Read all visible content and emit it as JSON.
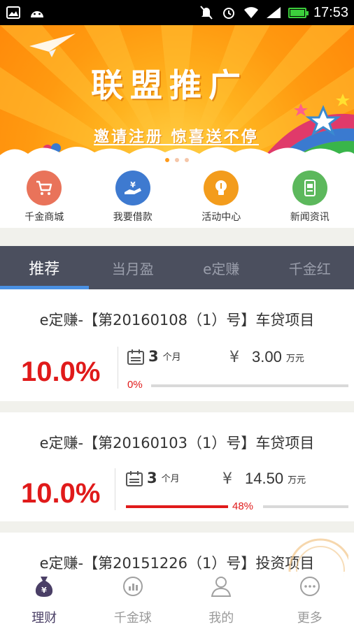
{
  "status_bar": {
    "time": "17:53",
    "left_icons": [
      "image-icon",
      "android-icon"
    ],
    "right_icons": [
      "mute-icon",
      "alarm-icon",
      "wifi-icon",
      "signal-icon",
      "battery-icon"
    ]
  },
  "banner": {
    "title": "联盟推广",
    "subtitle": "邀请注册 惊喜送不停",
    "page_count": 3,
    "active_page": 1
  },
  "quick_menu": [
    {
      "label": "千金商城",
      "icon": "shopping-cart-icon",
      "color": "#e9735a"
    },
    {
      "label": "我要借款",
      "icon": "loan-hand-icon",
      "color": "#3e7ad0"
    },
    {
      "label": "活动中心",
      "icon": "lightbulb-icon",
      "color": "#f39c1c"
    },
    {
      "label": "新闻资讯",
      "icon": "news-icon",
      "color": "#5cb85c"
    }
  ],
  "tabs": [
    {
      "label": "推荐",
      "active": true
    },
    {
      "label": "当月盈",
      "active": false
    },
    {
      "label": "e定赚",
      "active": false
    },
    {
      "label": "千金红",
      "active": false
    }
  ],
  "products": [
    {
      "title": "e定赚-【第20160108（1）号】车贷项目",
      "rate": "10.0%",
      "period": "3",
      "period_unit": "个月",
      "yen": "¥",
      "amount": "3.00",
      "amount_unit": "万元",
      "progress_label": "0%",
      "progress": 0
    },
    {
      "title": "e定赚-【第20160103（1）号】车贷项目",
      "rate": "10.0%",
      "period": "3",
      "period_unit": "个月",
      "yen": "¥",
      "amount": "14.50",
      "amount_unit": "万元",
      "progress_label": "48%",
      "progress": 0.48
    },
    {
      "title": "e定赚-【第20151226（1）号】投资项目"
    }
  ],
  "bottom_nav": [
    {
      "label": "理财",
      "icon": "money-bag-icon",
      "active": true
    },
    {
      "label": "千金球",
      "icon": "chart-circle-icon",
      "active": false
    },
    {
      "label": "我的",
      "icon": "person-icon",
      "active": false
    },
    {
      "label": "更多",
      "icon": "more-dots-icon",
      "active": false
    }
  ],
  "colors": {
    "accent_red": "#e01a1a",
    "tab_bar": "#4b4f5e",
    "tab_indicator": "#4a90e2",
    "banner_orange": "#ff9a10",
    "nav_active": "#4a3f66"
  }
}
